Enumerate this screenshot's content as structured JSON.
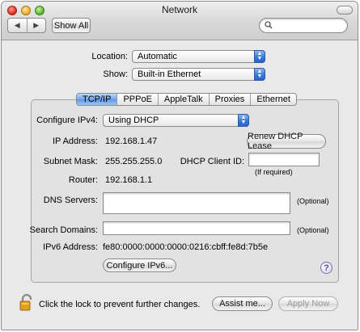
{
  "window": {
    "title": "Network"
  },
  "toolbar": {
    "back_glyph": "◀",
    "forward_glyph": "▶",
    "show_all_label": "Show All",
    "search_icon": "search-icon",
    "search_value": ""
  },
  "location": {
    "label": "Location:",
    "value": "Automatic"
  },
  "show": {
    "label": "Show:",
    "value": "Built-in Ethernet"
  },
  "tabs": [
    {
      "label": "TCP/IP",
      "active": true
    },
    {
      "label": "PPPoE",
      "active": false
    },
    {
      "label": "AppleTalk",
      "active": false
    },
    {
      "label": "Proxies",
      "active": false
    },
    {
      "label": "Ethernet",
      "active": false
    }
  ],
  "tcpip": {
    "configure_label": "Configure IPv4:",
    "configure_value": "Using DHCP",
    "ip_label": "IP Address:",
    "ip_value": "192.168.1.47",
    "renew_label": "Renew DHCP Lease",
    "subnet_label": "Subnet Mask:",
    "subnet_value": "255.255.255.0",
    "client_id_label": "DHCP Client ID:",
    "client_id_value": "",
    "if_required": "(If required)",
    "router_label": "Router:",
    "router_value": "192.168.1.1",
    "dns_label": "DNS Servers:",
    "dns_value": "",
    "dns_optional": "(Optional)",
    "search_domains_label": "Search Domains:",
    "search_domains_value": "",
    "search_domains_optional": "(Optional)",
    "ipv6_label": "IPv6 Address:",
    "ipv6_value": "fe80:0000:0000:0000:0216:cbff:fe8d:7b5e",
    "configure_ipv6_label": "Configure IPv6...",
    "help_glyph": "?"
  },
  "footer": {
    "lock_text": "Click the lock to prevent further changes.",
    "assist_label": "Assist me...",
    "apply_label": "Apply Now"
  },
  "colors": {
    "tab_active": "#6fa7ee",
    "popup_arrows": "#3a78d8"
  }
}
